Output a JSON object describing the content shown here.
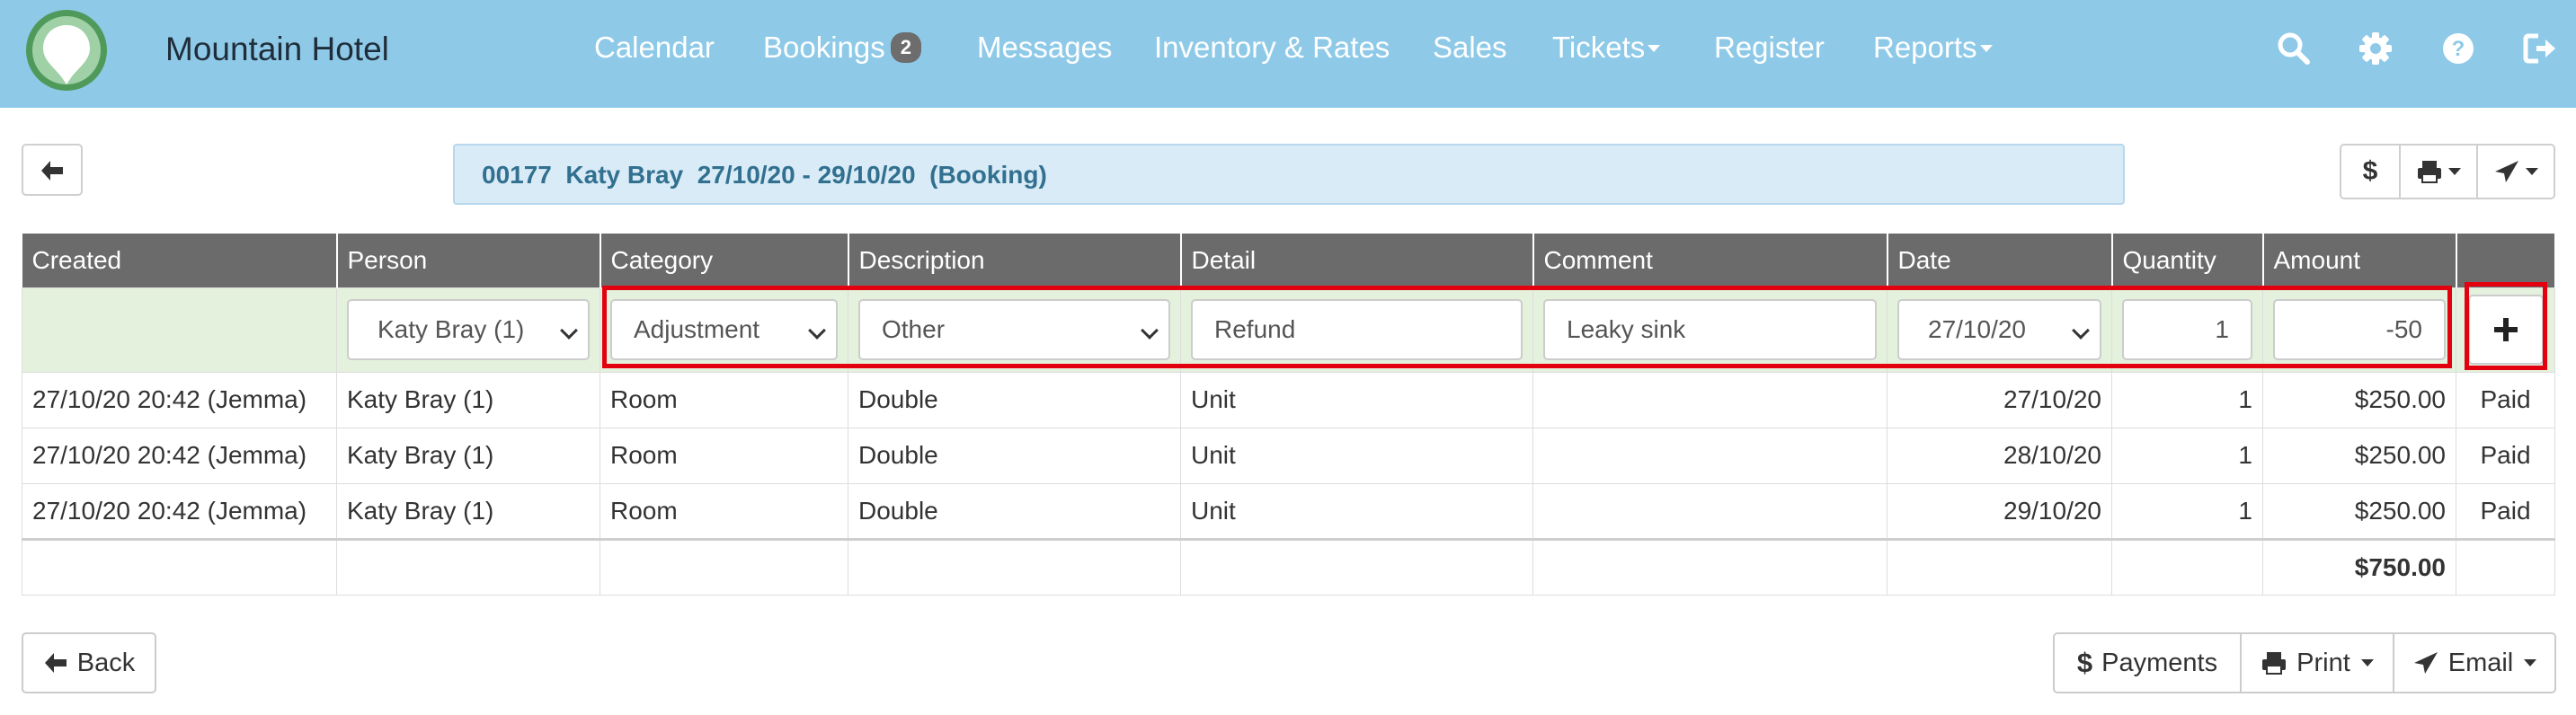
{
  "app": {
    "name": "Mountain Hotel",
    "logo_icon": "hotel-logo-icon"
  },
  "nav": {
    "items": [
      {
        "label": "Calendar"
      },
      {
        "label": "Bookings",
        "badge": "2"
      },
      {
        "label": "Messages"
      },
      {
        "label": "Inventory & Rates"
      },
      {
        "label": "Sales"
      },
      {
        "label": "Tickets",
        "dropdown": true
      },
      {
        "label": "Register"
      },
      {
        "label": "Reports",
        "dropdown": true
      }
    ],
    "icons": [
      "search-icon",
      "gear-icon",
      "help-icon",
      "logout-icon"
    ]
  },
  "toolbar": {
    "booking_info": "00177  Katy Bray  27/10/20 - 29/10/20  (Booking)",
    "dollar_label": "$"
  },
  "table": {
    "headers": [
      "Created",
      "Person",
      "Category",
      "Description",
      "Detail",
      "Comment",
      "Date",
      "Quantity",
      "Amount",
      ""
    ],
    "entry": {
      "person": "Katy Bray (1)",
      "category": "Adjustment",
      "description": "Other",
      "detail": "Refund",
      "comment": "Leaky sink",
      "date": "27/10/20",
      "quantity": "1",
      "amount": "-50"
    },
    "rows": [
      {
        "created": "27/10/20 20:42 (Jemma)",
        "person": "Katy Bray (1)",
        "category": "Room",
        "description": "Double",
        "detail": "Unit",
        "comment": "",
        "date": "27/10/20",
        "quantity": "1",
        "amount": "$250.00",
        "status": "Paid"
      },
      {
        "created": "27/10/20 20:42 (Jemma)",
        "person": "Katy Bray (1)",
        "category": "Room",
        "description": "Double",
        "detail": "Unit",
        "comment": "",
        "date": "28/10/20",
        "quantity": "1",
        "amount": "$250.00",
        "status": "Paid"
      },
      {
        "created": "27/10/20 20:42 (Jemma)",
        "person": "Katy Bray (1)",
        "category": "Room",
        "description": "Double",
        "detail": "Unit",
        "comment": "",
        "date": "29/10/20",
        "quantity": "1",
        "amount": "$250.00",
        "status": "Paid"
      }
    ],
    "total": "$750.00"
  },
  "footer": {
    "back_label": "Back",
    "payments_label": "Payments",
    "print_label": "Print",
    "email_label": "Email"
  },
  "colors": {
    "navbar": "#8ecae8",
    "header_row": "#6b6b6b",
    "entry_row": "#e4f1dc",
    "info_bar": "#d9ebf7",
    "highlight": "#e3000f"
  }
}
